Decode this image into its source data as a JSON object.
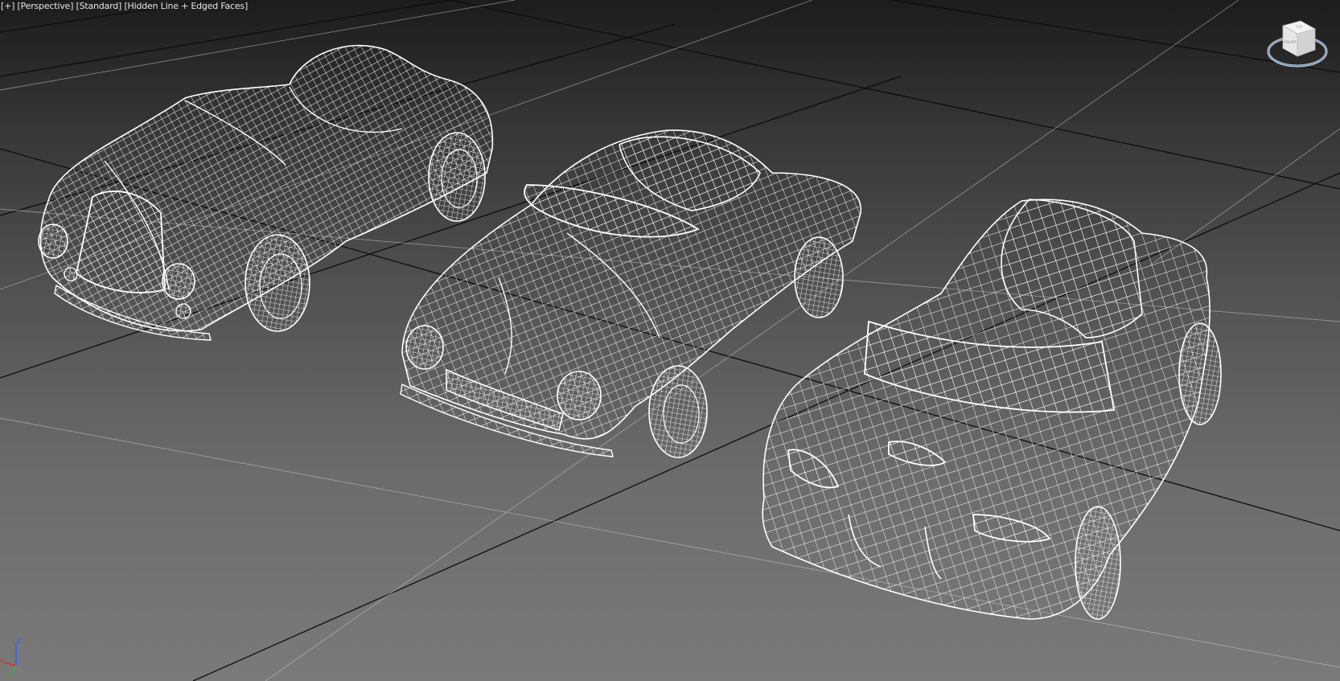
{
  "viewport": {
    "label_plus": "[+]",
    "label_view": "[Perspective]",
    "label_shading": "[Standard]",
    "label_style": "[Hidden Line + Edged Faces]"
  },
  "viewcube": {
    "face_front": "FRONT",
    "face_top": "TOP"
  },
  "axis_gizmo": {
    "x_label": "x",
    "y_label": "y",
    "z_label": "z",
    "x_color": "#e03030",
    "y_color": "#30c030",
    "z_color": "#3060ff"
  },
  "scene": {
    "objects": [
      "roadster-wireframe",
      "sedan-convertible-wireframe",
      "suv-convertible-wireframe"
    ],
    "wire_color": "#ffffff",
    "grid_color": "#0d0d0d"
  }
}
